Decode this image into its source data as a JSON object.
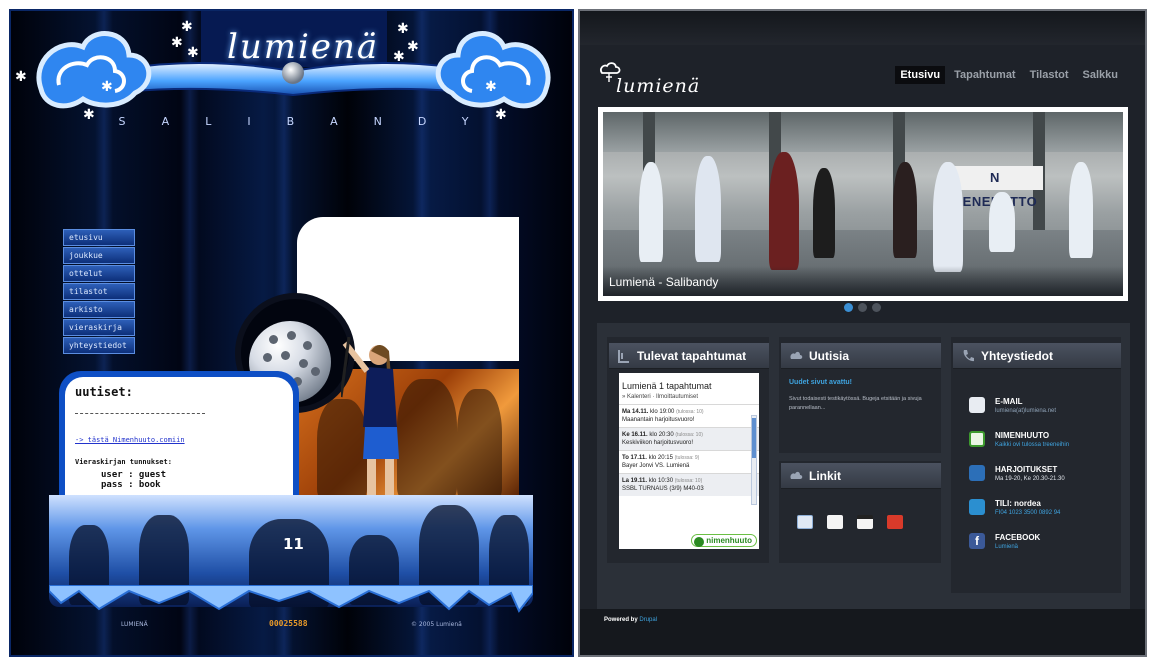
{
  "old_site": {
    "logo": "lumienä",
    "tagline": "SALIBANDY",
    "nav": [
      "etusivu",
      "joukkue",
      "ottelut",
      "tilastot",
      "arkisto",
      "vieraskirja",
      "yhteystiedot"
    ],
    "news": {
      "heading": "uutiset:",
      "link": "-> tästä Nimenhuuto.comiin",
      "guestbook_title": "Vieraskirjan tunnukset:",
      "captcha_line1": "user : guest",
      "captcha_line2": "pass : book"
    },
    "jersey_number": "11",
    "footer": {
      "left": "LUMIENÄ",
      "counter": "00025588",
      "right": "© 2005 Lumienä"
    }
  },
  "new_site": {
    "logo": "lumienä",
    "nav": [
      {
        "label": "Etusivu",
        "active": true
      },
      {
        "label": "Tapahtumat",
        "active": false
      },
      {
        "label": "Tilastot",
        "active": false
      },
      {
        "label": "Salkku",
        "active": false
      }
    ],
    "slider": {
      "caption": "Lumienä - Salibandy",
      "banner_text": "N BENEDETTO",
      "dot_count": 3,
      "active_dot": 0
    },
    "events": {
      "heading": "Tulevat tapahtumat",
      "box_title": "Lumienä 1 tapahtumat",
      "box_sub": "» Kalenteri · Ilmoittautumiset",
      "items": [
        {
          "date": "Ma 14.11.",
          "time": "klo 19:00",
          "note": "(tulossa: 10)",
          "title": "Maanantain harjoitusvuoro!"
        },
        {
          "date": "Ke 16.11.",
          "time": "klo 20:30",
          "note": "(tulossa: 10)",
          "title": "Keskiviikon harjoitusvuoro!"
        },
        {
          "date": "To 17.11.",
          "time": "klo 20:15",
          "note": "(tulossa: 9)",
          "title": "Bayer Jonvi VS. Lumienä"
        },
        {
          "date": "La 19.11.",
          "time": "klo 10:30",
          "note": "(tulossa: 10)",
          "title": "SSBL TURNAUS (3/9) M40-03"
        }
      ],
      "badge": "nimenhuuto"
    },
    "news": {
      "heading": "Uutisia",
      "title": "Uudet sivut avattu!",
      "text": "Sivut todaisesti testikäytössä. Bugeja etsitään ja sivuja parannellaan..."
    },
    "links": {
      "heading": "Linkit",
      "icons": [
        "nimenhuuto-icon",
        "salibandyliitto-icon",
        "floorball-icon",
        "sponsor-icon"
      ]
    },
    "contact": {
      "heading": "Yhteystiedot",
      "items": [
        {
          "label": "E-MAIL",
          "value": "lumiena(at)lumiena.net",
          "icon": "mail-icon"
        },
        {
          "label": "NIMENHUUTO",
          "value": "Kaikki ovi tulossa treeneihin",
          "icon": "nimenhuuto-icon"
        },
        {
          "label": "HARJOITUKSET",
          "value": "Ma 19-20, Ke 20.30-21.30",
          "icon": "calendar-icon"
        },
        {
          "label": "TILI: nordea",
          "value": "FI04 1023 3500 0892 94",
          "icon": "bank-icon"
        },
        {
          "label": "FACEBOOK",
          "value": "Lumienä",
          "icon": "facebook-icon"
        }
      ]
    },
    "footer": {
      "powered_label": "Powered by",
      "powered_link": "Drupal"
    }
  },
  "colors": {
    "old_bg": "#020a22",
    "old_accent": "#0e4fc5",
    "new_bg": "#1e2229",
    "new_link": "#3fa4e0",
    "nav_active_bg": "#0b0c0f"
  }
}
